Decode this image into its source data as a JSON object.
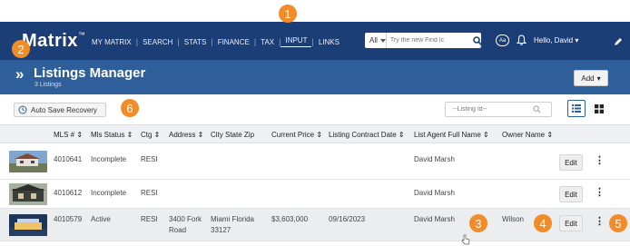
{
  "app": {
    "logo": "Matrix",
    "logo_tm": "™"
  },
  "nav": {
    "links": [
      "MY MATRIX",
      "SEARCH",
      "STATS",
      "FINANCE",
      "TAX",
      "INPUT",
      "LINKS"
    ],
    "active": "INPUT",
    "search_scope": "All",
    "search_placeholder": "Try the new Find Ic",
    "accessibility_label": "Aa",
    "user_greeting": "Hello, David"
  },
  "header": {
    "title": "Listings Manager",
    "count": "3 Listings",
    "add_label": "Add"
  },
  "toolbar": {
    "auto_save_label": "Auto Save Recovery",
    "listing_id_placeholder": "--Listing Id--"
  },
  "table": {
    "columns": [
      "MLS # ⇕",
      "Mls Status ⇕",
      "Ctg ⇕",
      "Address ⇕",
      "City State Zip",
      "Current Price ⇕",
      "Listing Contract Date ⇕",
      "List Agent Full Name ⇕",
      "Owner Name ⇕"
    ],
    "rows": [
      {
        "mls": "4010641",
        "status": "Incomplete",
        "ctg": "RESI",
        "address": "",
        "city": "",
        "price": "",
        "date": "",
        "agent": "David Marsh",
        "owner": "",
        "edit": "Edit"
      },
      {
        "mls": "4010612",
        "status": "Incomplete",
        "ctg": "RESI",
        "address": "",
        "city": "",
        "price": "",
        "date": "",
        "agent": "David Marsh",
        "owner": "",
        "edit": "Edit"
      },
      {
        "mls": "4010579",
        "status": "Active",
        "ctg": "RESI",
        "address": "3400 Fork Road",
        "city": "Miami Florida 33127",
        "price": "$3,603,000",
        "date": "09/16/2023",
        "agent": "David Marsh",
        "owner": "Wilson",
        "edit": "Edit"
      }
    ]
  },
  "callouts": [
    "1",
    "2",
    "3",
    "4",
    "5",
    "6"
  ],
  "colors": {
    "nav_bg": "#1b3e76",
    "subheader_bg": "#2f5f9a",
    "callout": "#f28c28"
  }
}
